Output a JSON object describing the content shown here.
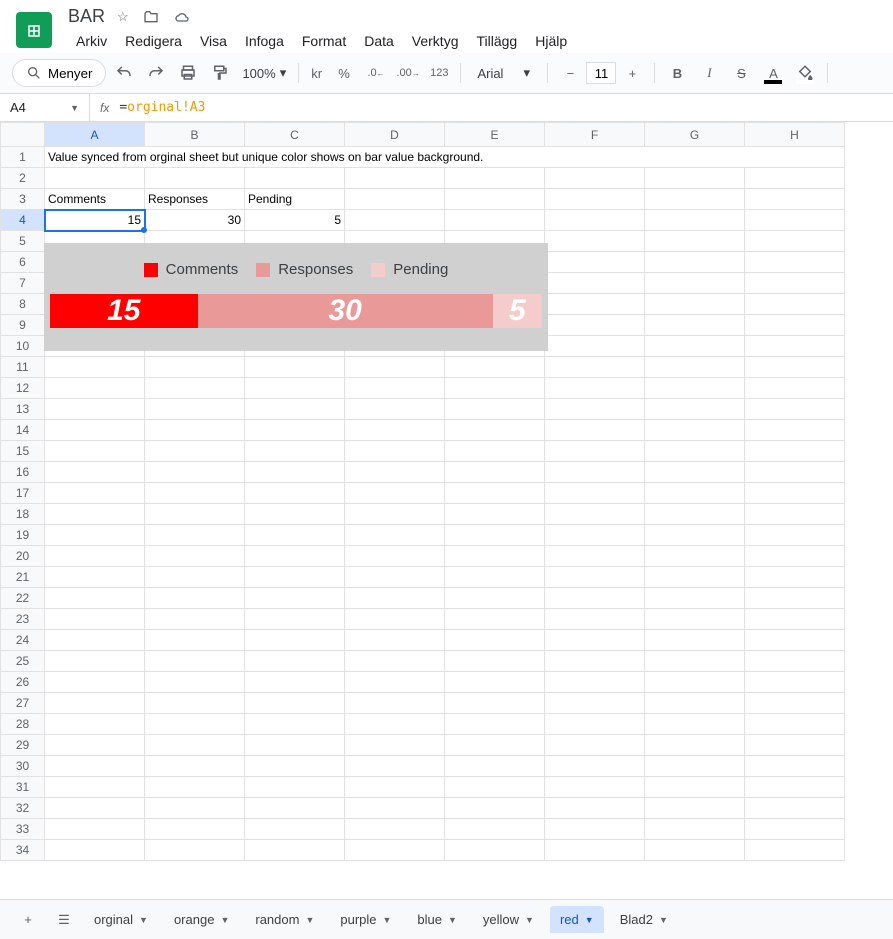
{
  "header": {
    "doc_title": "BAR",
    "menus": [
      "Arkiv",
      "Redigera",
      "Visa",
      "Infoga",
      "Format",
      "Data",
      "Verktyg",
      "Tillägg",
      "Hjälp"
    ]
  },
  "toolbar": {
    "menus_label": "Menyer",
    "zoom": "100%",
    "currency": "kr",
    "percent": "%",
    "dec_dec": ".0",
    "inc_dec": ".00",
    "numfmt": "123",
    "font_name": "Arial",
    "font_size": "11"
  },
  "name_box": "A4",
  "formula": {
    "eq": "=",
    "ref": "orginal!A3"
  },
  "columns": [
    "A",
    "B",
    "C",
    "D",
    "E",
    "F",
    "G",
    "H"
  ],
  "row_count": 35,
  "cells": {
    "A1": "Value synced from orginal sheet but unique color shows on bar value background.",
    "A3": "Comments",
    "B3": "Responses",
    "C3": "Pending",
    "A4": "15",
    "B4": "30",
    "C4": "5"
  },
  "selected_cell": "A4",
  "chart_data": {
    "type": "bar",
    "orientation": "horizontal-stacked",
    "series": [
      {
        "name": "Comments",
        "value": 15,
        "color": "#ff0000"
      },
      {
        "name": "Responses",
        "value": 30,
        "color": "#ea9999"
      },
      {
        "name": "Pending",
        "value": 5,
        "color": "#f4cccc"
      }
    ]
  },
  "sheet_tabs": {
    "tabs": [
      "orginal",
      "orange",
      "random",
      "purple",
      "blue",
      "yellow",
      "red",
      "Blad2"
    ],
    "active": "red"
  }
}
